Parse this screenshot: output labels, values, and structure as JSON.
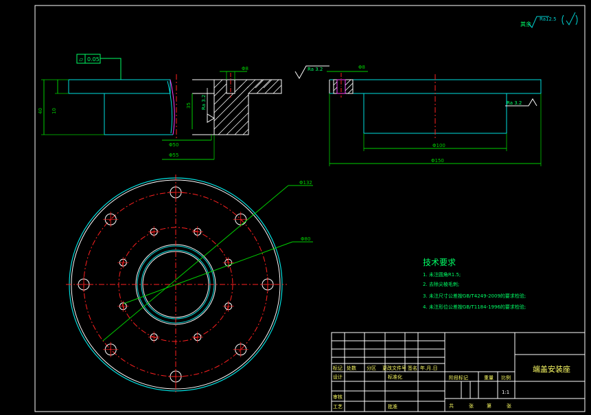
{
  "colors": {
    "background": "#000000",
    "outline": "#ffffff",
    "part": "#00e0e0",
    "center_line": "#ff2020",
    "dimension": "#00d000",
    "text_green": "#00ff66",
    "title_text": "#ffff66",
    "magenta": "#ff40ff"
  },
  "surface_finish_note": {
    "prefix": "其余",
    "roughness": "Ra12.5"
  },
  "flatness_tolerance": "0.05",
  "dimensions": {
    "phi8_left": "Φ8",
    "phi8_right": "Φ8",
    "phi50": "Φ50",
    "phi55": "Φ55",
    "h40": "40",
    "h10": "10",
    "h35": "35",
    "ra32_left": "Ra 3.2",
    "ra32_top": "Ra 3.2",
    "ra32_right": "Ra 3.2",
    "phi100": "Φ100",
    "phi150": "Φ150",
    "phi132": "Φ132",
    "phi80": "Φ80"
  },
  "technical_requirements": {
    "heading": "技术要求",
    "items": [
      "1. 未注圆角R1.5;",
      "2. 去除尖棱毛刺;",
      "3. 未注尺寸公差按GB/T4249-2009的要求检验;",
      "4. 未注形位公差按GB/T1184-1996的要求检验;"
    ]
  },
  "title_block": {
    "drawing_name": "端盖安装座",
    "revision_row": [
      "标记",
      "处数",
      "分区",
      "更改文件号",
      "签名",
      "年.月.日"
    ],
    "design": "设计",
    "standardize": "标准化",
    "review": "审核",
    "process": "工艺",
    "approve": "批准",
    "stage_mark": "阶段标记",
    "weight": "重量",
    "scale": "比例",
    "scale_value": "1:1",
    "sheets_total": "共",
    "sheet_label": "张",
    "sheet_of": "第",
    "sheet_label2": "张"
  }
}
